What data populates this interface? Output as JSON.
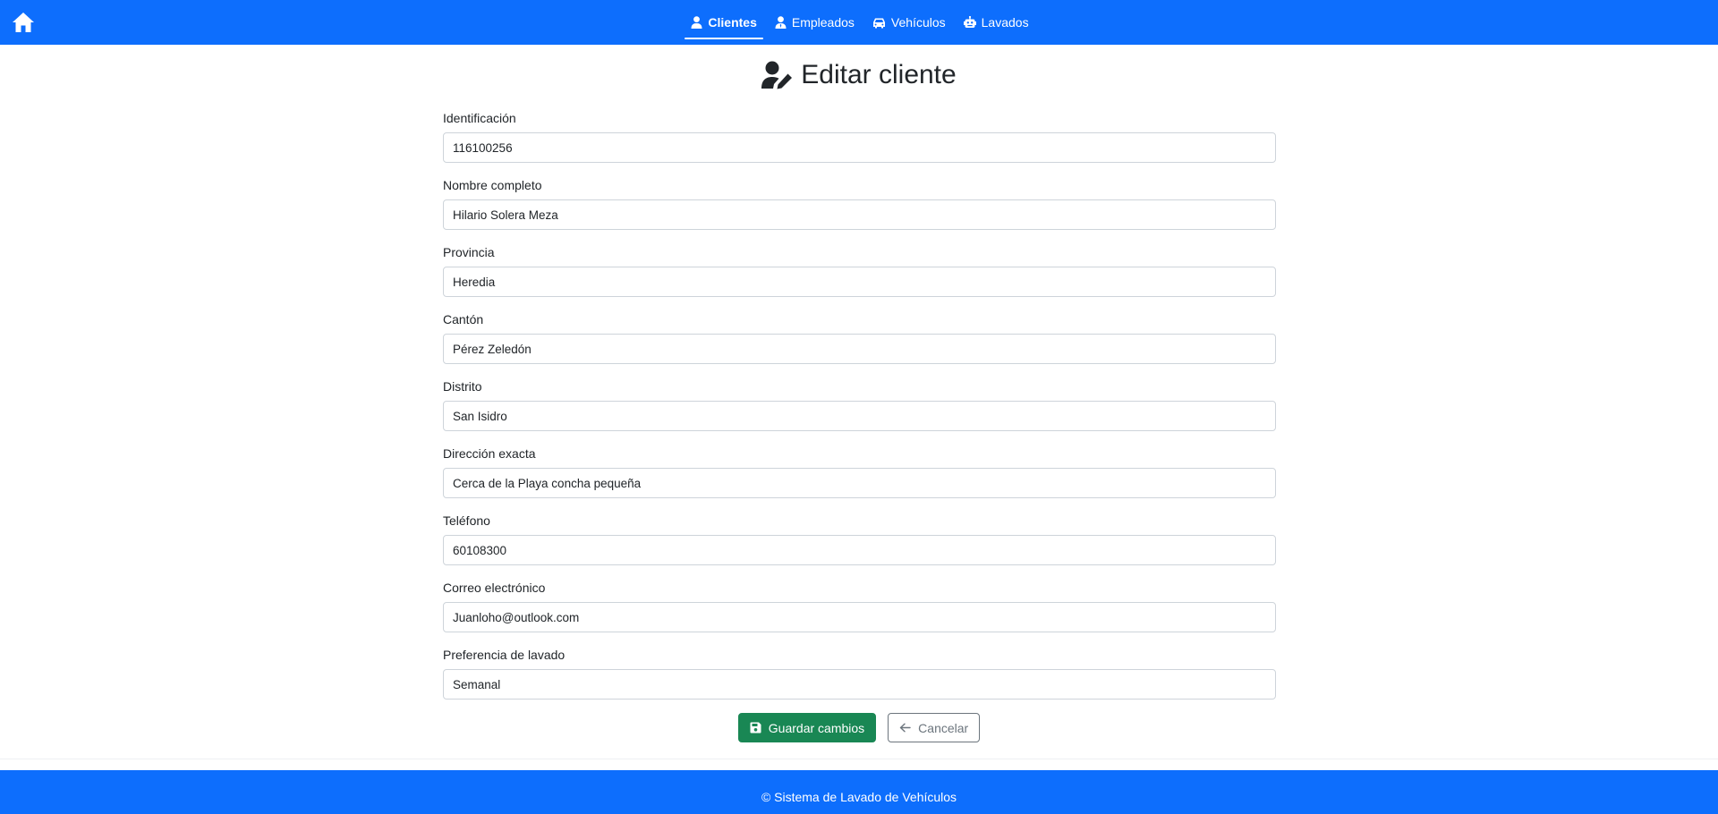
{
  "nav": {
    "home_icon": "home-icon",
    "items": [
      {
        "label": "Clientes",
        "icon": "user-icon",
        "active": true
      },
      {
        "label": "Empleados",
        "icon": "user-tie-icon",
        "active": false
      },
      {
        "label": "Vehículos",
        "icon": "car-icon",
        "active": false
      },
      {
        "label": "Lavados",
        "icon": "washing-robot-icon",
        "active": false
      }
    ]
  },
  "page": {
    "title": "Editar cliente",
    "title_icon": "user-edit-icon"
  },
  "form": {
    "fields": [
      {
        "label": "Identificación",
        "value": "116100256"
      },
      {
        "label": "Nombre completo",
        "value": "Hilario Solera Meza"
      },
      {
        "label": "Provincia",
        "value": "Heredia"
      },
      {
        "label": "Cantón",
        "value": "Pérez Zeledón"
      },
      {
        "label": "Distrito",
        "value": "San Isidro"
      },
      {
        "label": "Dirección exacta",
        "value": "Cerca de la Playa concha pequeña"
      },
      {
        "label": "Teléfono",
        "value": "60108300"
      },
      {
        "label": "Correo electrónico",
        "value": "Juanloho@outlook.com"
      },
      {
        "label": "Preferencia de lavado",
        "value": "Semanal"
      }
    ]
  },
  "actions": {
    "save_label": "Guardar cambios",
    "save_icon": "floppy-disk-icon",
    "cancel_label": "Cancelar",
    "cancel_icon": "arrow-left-icon"
  },
  "footer": {
    "text": "© Sistema de Lavado de Vehículos"
  },
  "colors": {
    "primary": "#0d6efd",
    "success": "#198754",
    "secondary": "#6c757d"
  }
}
